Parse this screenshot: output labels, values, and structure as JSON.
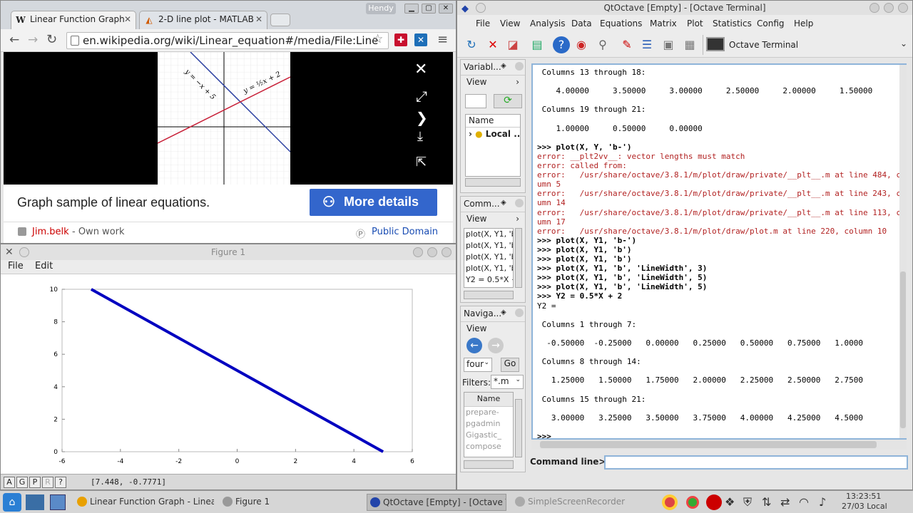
{
  "browser": {
    "tabs": [
      {
        "label": "Linear Function Graph",
        "icon": "W"
      },
      {
        "label": "2-D line plot - MATLAB",
        "icon": "◭"
      }
    ],
    "user_badge": "Hendy",
    "address": "en.wikipedia.org/wiki/Linear_equation#/media/File:Line",
    "image_eq1": "y = −x + 5",
    "image_eq2": "y = ½x + 2",
    "caption": "Graph sample of linear equations.",
    "more_details": "More details",
    "author": "Jim.belk",
    "author_suffix": " - Own work",
    "license": "Public Domain"
  },
  "figure": {
    "title": "Figure 1",
    "menu": [
      "File",
      "Edit"
    ],
    "status_buttons": [
      "A",
      "G",
      "P",
      "R",
      "?"
    ],
    "coords": "[7.448, -0.7771]"
  },
  "chart_data": {
    "type": "line",
    "x": [
      -5,
      5
    ],
    "series": [
      {
        "values": [
          10,
          0
        ],
        "color": "#0000c0"
      }
    ],
    "xlim": [
      -6,
      6
    ],
    "ylim": [
      0,
      10
    ],
    "xticks": [
      "-6",
      "-4",
      "-2",
      "0",
      "2",
      "4",
      "6"
    ],
    "yticks": [
      "0",
      "2",
      "4",
      "6",
      "8",
      "10"
    ],
    "grid": false
  },
  "octave": {
    "title": "QtOctave [Empty] - [Octave Terminal]",
    "menu": [
      "File",
      "View",
      "Analysis",
      "Data",
      "Equations",
      "Matrix",
      "Plot",
      "Statistics",
      "Config",
      "Help"
    ],
    "terminal_tab": "Octave Terminal",
    "variables_dock": {
      "title": "Variabl...",
      "view": "View",
      "col_header": "Name",
      "local": "Local ..."
    },
    "commands_dock": {
      "title": "Comm...",
      "view": "View",
      "items": [
        "plot(X, Y1, 'b-",
        "plot(X, Y1, 'b')",
        "plot(X, Y1, 'b'",
        "plot(X, Y1, 'b'",
        "Y2 = 0.5*X +"
      ]
    },
    "nav_dock": {
      "title": "Naviga...",
      "view": "View",
      "dir": "four",
      "go": "Go",
      "filters_label": "Filters:",
      "filter": "*.m",
      "col_header": "Name",
      "files": [
        "prepare-",
        "pgadmin",
        "Gigastic_",
        "compose"
      ]
    },
    "terminal_lines": [
      {
        "t": " Columns 13 through 18:",
        "c": "out"
      },
      {
        "t": "",
        "c": "out"
      },
      {
        "t": "    4.00000     3.50000     3.00000     2.50000     2.00000     1.50000",
        "c": "out"
      },
      {
        "t": "",
        "c": "out"
      },
      {
        "t": " Columns 19 through 21:",
        "c": "out"
      },
      {
        "t": "",
        "c": "out"
      },
      {
        "t": "    1.00000     0.50000     0.00000",
        "c": "out"
      },
      {
        "t": "",
        "c": "out"
      },
      {
        "t": ">>> plot(X, Y, 'b-')",
        "c": "cmd"
      },
      {
        "t": "error: __plt2vv__: vector lengths must match",
        "c": "err"
      },
      {
        "t": "error: called from:",
        "c": "err"
      },
      {
        "t": "error:   /usr/share/octave/3.8.1/m/plot/draw/private/__plt__.m at line 484, c",
        "c": "err"
      },
      {
        "t": "umn 5",
        "c": "err"
      },
      {
        "t": "error:   /usr/share/octave/3.8.1/m/plot/draw/private/__plt__.m at line 243, c",
        "c": "err"
      },
      {
        "t": "umn 14",
        "c": "err"
      },
      {
        "t": "error:   /usr/share/octave/3.8.1/m/plot/draw/private/__plt__.m at line 113, c",
        "c": "err"
      },
      {
        "t": "umn 17",
        "c": "err"
      },
      {
        "t": "error:   /usr/share/octave/3.8.1/m/plot/draw/plot.m at line 220, column 10",
        "c": "err"
      },
      {
        "t": ">>> plot(X, Y1, 'b-')",
        "c": "cmd"
      },
      {
        "t": ">>> plot(X, Y1, 'b')",
        "c": "cmd"
      },
      {
        "t": ">>> plot(X, Y1, 'b')",
        "c": "cmd"
      },
      {
        "t": ">>> plot(X, Y1, 'b', 'LineWidth', 3)",
        "c": "cmd"
      },
      {
        "t": ">>> plot(X, Y1, 'b', 'LineWidth', 5)",
        "c": "cmd"
      },
      {
        "t": ">>> plot(X, Y1, 'b', 'LineWidth', 5)",
        "c": "cmd"
      },
      {
        "t": ">>> Y2 = 0.5*X + 2",
        "c": "cmd"
      },
      {
        "t": "Y2 =",
        "c": "out"
      },
      {
        "t": "",
        "c": "out"
      },
      {
        "t": " Columns 1 through 7:",
        "c": "out"
      },
      {
        "t": "",
        "c": "out"
      },
      {
        "t": "  -0.50000  -0.25000   0.00000   0.25000   0.50000   0.75000   1.0000",
        "c": "out"
      },
      {
        "t": "",
        "c": "out"
      },
      {
        "t": " Columns 8 through 14:",
        "c": "out"
      },
      {
        "t": "",
        "c": "out"
      },
      {
        "t": "   1.25000   1.50000   1.75000   2.00000   2.25000   2.50000   2.7500",
        "c": "out"
      },
      {
        "t": "",
        "c": "out"
      },
      {
        "t": " Columns 15 through 21:",
        "c": "out"
      },
      {
        "t": "",
        "c": "out"
      },
      {
        "t": "   3.00000   3.25000   3.50000   3.75000   4.00000   4.25000   4.5000",
        "c": "out"
      },
      {
        "t": "",
        "c": "out"
      },
      {
        "t": ">>>",
        "c": "cmd"
      }
    ],
    "command_line_label": "Command line>>",
    "command_line_value": ""
  },
  "taskbar": {
    "tasks": [
      "Linear Function Graph - Linear e",
      "Figure 1",
      "QtOctave [Empty] - [Octave Term",
      "SimpleScreenRecorder"
    ],
    "time": "13:23:51",
    "date": "27/03 Local"
  }
}
